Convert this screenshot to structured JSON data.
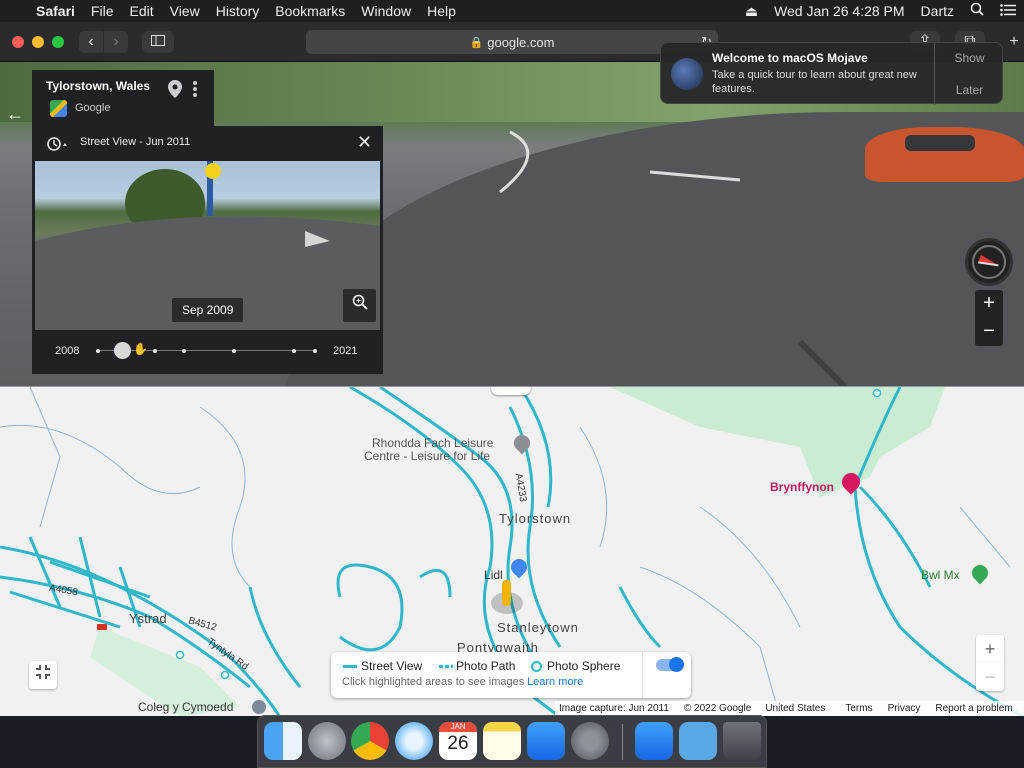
{
  "menubar": {
    "app": "Safari",
    "items": [
      "File",
      "Edit",
      "View",
      "History",
      "Bookmarks",
      "Window",
      "Help"
    ],
    "datetime": "Wed Jan 26  4:28 PM",
    "user": "Dartz"
  },
  "toolbar": {
    "url": "google.com"
  },
  "notification": {
    "title": "Welcome to macOS Mojave",
    "body": "Take a quick tour to learn about great new features.",
    "show_label": "Show",
    "later_label": "Later"
  },
  "infocard": {
    "place": "Tylorstown, Wales",
    "source": "Google"
  },
  "streetview_panel": {
    "title": "Street View - Jun 2011",
    "tooltip": "Sep 2009",
    "year_start": "2008",
    "year_end": "2021",
    "timeline_position": 0.1
  },
  "map": {
    "labels": {
      "leisure": "Rhondda Fach Leisure",
      "leisure2": "Centre - Leisure for Life",
      "road_a4233": "A4233",
      "tylorstown": "Tylorstown",
      "lidl": "Lidl",
      "stanleytown": "Stanleytown",
      "pontygwaith": "Pontygwaith",
      "ystrad": "Ystrad",
      "a4058": "A4058",
      "b4512": "B4512",
      "tyntyla": "Tyntyla Rd",
      "brynffynon": "Brynffynon",
      "bwlmx": "Bwl Mx",
      "coleg": "Coleg y Cymoedd"
    }
  },
  "legend": {
    "street_view": "Street View",
    "photo_path": "Photo Path",
    "photo_sphere": "Photo Sphere",
    "hint": "Click highlighted areas to see images",
    "learn_more": "Learn more"
  },
  "attribution": {
    "capture": "Image capture: Jun 2011",
    "copyright": "© 2022 Google",
    "country": "United States",
    "terms": "Terms",
    "privacy": "Privacy",
    "report": "Report a problem"
  },
  "dock": {
    "calendar_month": "JAN",
    "calendar_day": "26"
  },
  "colors": {
    "map_road": "#2fb7c9",
    "map_bg": "#f1f1f2",
    "park": "#c9ecd3",
    "toggle": "#1a73e8",
    "hotel_pin": "#d81b60",
    "poi_pin": "#34a853"
  }
}
